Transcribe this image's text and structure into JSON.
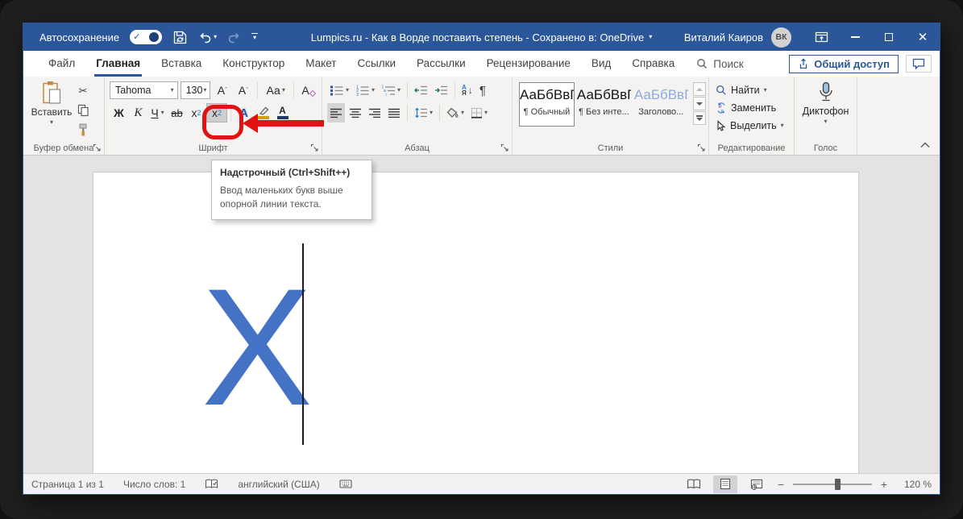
{
  "colors": {
    "accent": "#2b579a",
    "annotation_red": "#e01212",
    "document_text_blue": "#4472c4"
  },
  "icons": {
    "check": "✓",
    "close": "✕",
    "scissors": "✂",
    "caret_down": "▾",
    "pilcrow": "¶",
    "minus": "−",
    "plus": "+",
    "grow_caret": "ˆ",
    "shrink_caret": "ˇ",
    "sort_top": "А",
    "sort_bottom": "Я",
    "sort_arrow": "↓"
  },
  "titlebar": {
    "autosave_label": "Автосохранение",
    "title": "Lumpics.ru - Как в Ворде поставить степень - Сохранено в: OneDrive",
    "user_name": "Виталий Каиров",
    "avatar_initials": "ВК"
  },
  "tabs": {
    "items": [
      "Файл",
      "Главная",
      "Вставка",
      "Конструктор",
      "Макет",
      "Ссылки",
      "Рассылки",
      "Рецензирование",
      "Вид",
      "Справка"
    ],
    "search_label": "Поиск",
    "share_label": "Общий доступ"
  },
  "ribbon": {
    "clipboard": {
      "paste_label": "Вставить",
      "group_label": "Буфер обмена"
    },
    "font": {
      "family": "Tahoma",
      "size": "130",
      "bold": "Ж",
      "italic": "К",
      "underline": "Ч",
      "strikethrough": "ab",
      "script_base": "x",
      "script_num": "2",
      "grow_base": "А",
      "case_label": "Аа",
      "clear_base": "А",
      "effects": "А",
      "fontcolor": "А",
      "group_label": "Шрифт"
    },
    "paragraph": {
      "group_label": "Абзац"
    },
    "styles": {
      "items": [
        {
          "preview": "АаБбВвГ",
          "name": "¶ Обычный"
        },
        {
          "preview": "АаБбВвГ",
          "name": "¶ Без инте..."
        },
        {
          "preview": "АаБбВвГ",
          "name": "Заголово..."
        }
      ],
      "group_label": "Стили"
    },
    "editing": {
      "find": "Найти",
      "replace": "Заменить",
      "select": "Выделить",
      "group_label": "Редактирование"
    },
    "voice": {
      "dictate": "Диктофон",
      "group_label": "Голос"
    }
  },
  "tooltip": {
    "title": "Надстрочный (Ctrl+Shift++)",
    "body": "Ввод маленьких букв выше опорной линии текста."
  },
  "document": {
    "text": "X"
  },
  "statusbar": {
    "page_info": "Страница 1 из 1",
    "word_count": "Число слов: 1",
    "language": "английский (США)",
    "zoom_level": "120 %"
  }
}
